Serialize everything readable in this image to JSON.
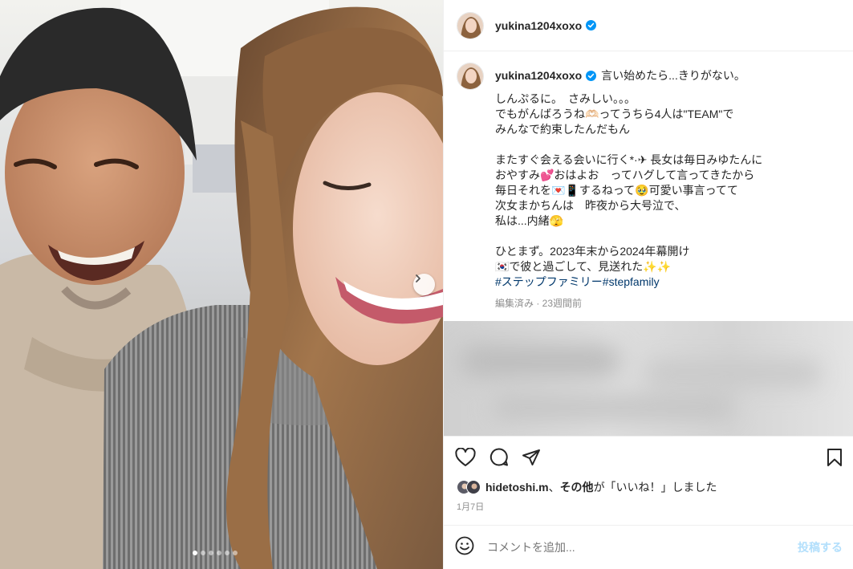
{
  "post": {
    "username": "yukina1204xoxo",
    "verified": true,
    "caption_first_line": "言い始めたら...きりがない。",
    "caption_body": "しんぷるに。　さみしい。。。\nでもがんばろうね🫶🏻ってうちら4人は\"TEAM\"で\nみんなで約束したんだもん\n\nまたすぐ会える会いに行く*·✈ 長女は毎日みゆたんに\nおやすみ💕おはよお　ってハグして言ってきたから\n毎日それを💌📱するねって🥹可愛い事言ってて\n次女まかちんは　昨夜から大号泣で、\n私は...内緒🫣\n\nひとまず。2023年末から2024年幕開け\n🇰🇷で彼と過ごして、見送れた✨✨",
    "hashtags": "#ステップファミリー#stepfamily",
    "meta": "編集済み · 23週間前"
  },
  "likes": {
    "user": "hidetoshi.m",
    "separator": "、",
    "others": "その他",
    "suffix": "が「いいね！」しました"
  },
  "date": "1月7日",
  "comment": {
    "placeholder": "コメントを追加...",
    "post_label": "投稿する"
  },
  "carousel": {
    "slide_count": 6,
    "active_index": 0
  },
  "colors": {
    "verified": "#0095f6",
    "hashtag": "#00376b",
    "post_button": "#b2dffc"
  }
}
